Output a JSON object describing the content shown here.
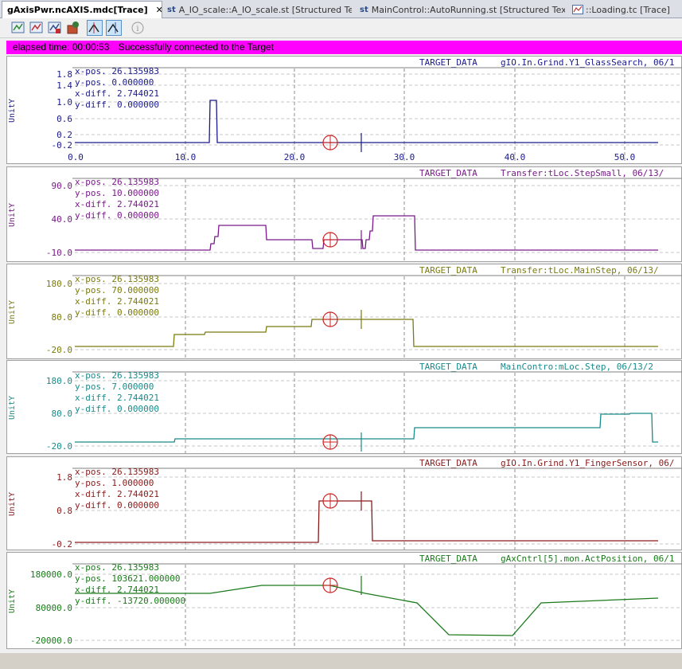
{
  "tabs": [
    {
      "label": "gAxisPwr.ncAXIS.mdc[Trace]",
      "active": true,
      "close": "✕"
    },
    {
      "prefix": "st",
      "label": "A_IO_scale::A_IO_scale.st [Structured Text]",
      "active": false
    },
    {
      "prefix": "st",
      "label": "MainControl::AutoRunning.st [Structured Text]",
      "active": false
    },
    {
      "label": "::Loading.tc [Trace]",
      "active": false
    }
  ],
  "toolbar": {
    "buttons": [
      "trace-start-icon",
      "trace-stop-icon",
      "trace-upload-icon",
      "trace-config-icon",
      "cursor-a-icon",
      "cursor-b-icon",
      "info-icon"
    ]
  },
  "status": {
    "elapsed": "elapsed time: 00:00:53",
    "message": "Successfully connected to the Target",
    "color": "#ff00ff"
  },
  "cursor": {
    "x_pos": "26.135983",
    "x_diff": "2.744021",
    "y_diff": "0.000000"
  },
  "x_axis": {
    "ticks": [
      "0.0",
      "10.0",
      "20.0",
      "30.0",
      "40.0",
      "50.0"
    ]
  },
  "chart_data": [
    {
      "type": "line",
      "source": "TARGET_DATA",
      "title": "gIO.In.Grind.Y1_GlassSearch, 06/1",
      "ylabel": "UnitY",
      "color": "#1a1a8c",
      "yticks": [
        "1.8",
        "1.4",
        "1.0",
        "0.6",
        "0.2",
        "-0.2"
      ],
      "readout": {
        "x_pos": "x-pos. 26.135983",
        "y_pos": "y-pos. 0.000000",
        "x_diff": "x-diff. 2.744021",
        "y_diff": "y-diff. 0.000000"
      },
      "x": [
        0,
        12.4,
        12.4,
        12.9,
        12.9,
        53.0
      ],
      "y": [
        0,
        0,
        1,
        1,
        0,
        0
      ]
    },
    {
      "type": "line",
      "source": "TARGET_DATA",
      "title": "Transfer:tLoc.StepSmall, 06/13/",
      "ylabel": "UnitY",
      "color": "#7a1a8a",
      "yticks": [
        "90.0",
        "40.0",
        "-10.0"
      ],
      "readout": {
        "x_pos": "x-pos. 26.135983",
        "y_pos": "y-pos. 10.000000",
        "x_diff": "x-diff. 2.744021",
        "y_diff": "y-diff. 0.000000"
      }
    },
    {
      "type": "line",
      "source": "TARGET_DATA",
      "title": "Transfer:tLoc.MainStep, 06/13/",
      "ylabel": "UnitY",
      "color": "#7a7a10",
      "yticks": [
        "180.0",
        "80.0",
        "-20.0"
      ],
      "readout": {
        "x_pos": "x-pos. 26.135983",
        "y_pos": "y-pos. 70.000000",
        "x_diff": "x-diff. 2.744021",
        "y_diff": "y-diff. 0.000000"
      }
    },
    {
      "type": "line",
      "source": "TARGET_DATA",
      "title": "MainContro:mLoc.Step, 06/13/2",
      "ylabel": "UnitY",
      "color": "#1a8a8a",
      "yticks": [
        "180.0",
        "80.0",
        "-20.0"
      ],
      "readout": {
        "x_pos": "x-pos. 26.135983",
        "y_pos": "y-pos. 7.000000",
        "x_diff": "x-diff. 2.744021",
        "y_diff": "y-diff. 0.000000"
      }
    },
    {
      "type": "line",
      "source": "TARGET_DATA",
      "title": "gIO.In.Grind.Y1_FingerSensor, 06/",
      "ylabel": "UnitY",
      "color": "#8a1a1a",
      "yticks": [
        "1.8",
        "0.8",
        "-0.2"
      ],
      "readout": {
        "x_pos": "x-pos. 26.135983",
        "y_pos": "y-pos. 1.000000",
        "x_diff": "x-diff. 2.744021",
        "y_diff": "y-diff. 0.000000"
      }
    },
    {
      "type": "line",
      "source": "TARGET_DATA",
      "title": "gAxCntrl[5].mon.ActPosition, 06/1",
      "ylabel": "UnitY",
      "color": "#1a7a1a",
      "yticks": [
        "180000.0",
        "80000.0",
        "-20000.0"
      ],
      "readout": {
        "x_pos": "x-pos.      26.135983",
        "y_pos": "y-pos.  103621.000000",
        "x_diff": "x-diff.      2.744021",
        "y_diff": "y-diff. -13720.000000"
      }
    }
  ]
}
